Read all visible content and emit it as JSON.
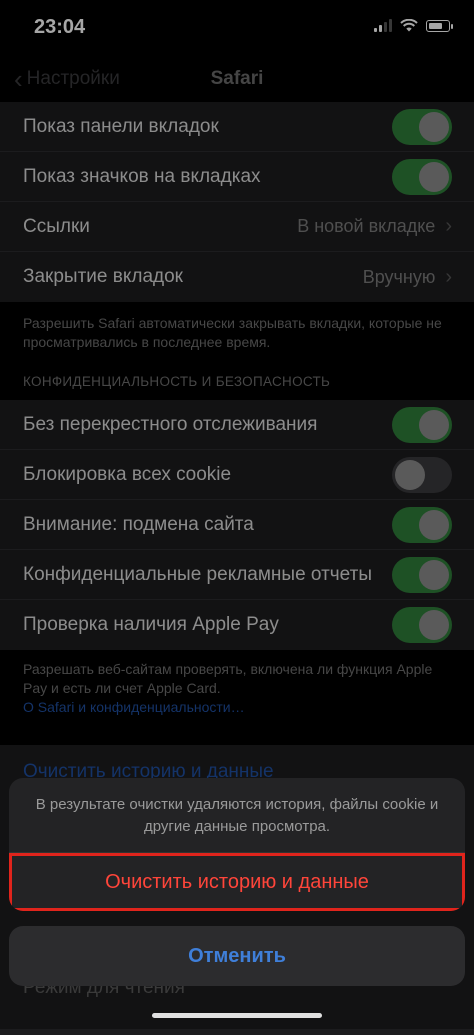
{
  "status_bar": {
    "time": "23:04"
  },
  "nav": {
    "back_label": "Настройки",
    "title": "Safari"
  },
  "tabs_group": [
    {
      "label": "Показ панели вкладок",
      "toggle": true
    },
    {
      "label": "Показ значков на вкладках",
      "toggle": true
    },
    {
      "label": "Ссылки",
      "value": "В новой вкладке"
    },
    {
      "label": "Закрытие вкладок",
      "value": "Вручную"
    }
  ],
  "tabs_footnote": "Разрешить Safari автоматически закрывать вкладки, которые не просматривались в последнее время.",
  "privacy_header": "КОНФИДЕНЦИАЛЬНОСТЬ И БЕЗОПАСНОСТЬ",
  "privacy_group": [
    {
      "label": "Без перекрестного отслеживания",
      "toggle": true
    },
    {
      "label": "Блокировка всех cookie",
      "toggle": false
    },
    {
      "label": "Внимание: подмена сайта",
      "toggle": true
    },
    {
      "label": "Конфиденциальные рекламные отчеты",
      "toggle": true
    },
    {
      "label": "Проверка наличия Apple Pay",
      "toggle": true
    }
  ],
  "privacy_footnote": "Разрешать веб-сайтам проверять, включена ли функция Apple Pay и есть ли счет Apple Card.",
  "privacy_link": "О Safari и конфиденциальности…",
  "clear_history_row": "Очистить историю и данные",
  "reader_row": "Режим для чтения",
  "action_sheet": {
    "message": "В результате очистки удаляются история, файлы cookie и другие данные просмотра.",
    "confirm_label": "Очистить историю и данные",
    "cancel_label": "Отменить"
  },
  "colors": {
    "toggle_on": "#2e7d3a",
    "destructive": "#ff453a",
    "link": "#3f7fd9"
  }
}
